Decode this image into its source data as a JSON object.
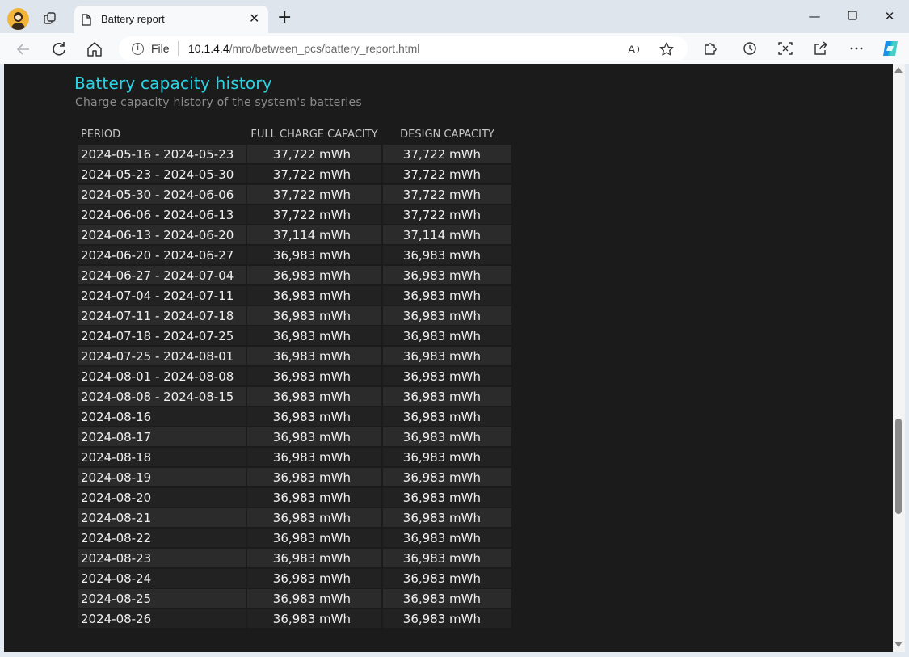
{
  "browser": {
    "tab_title": "Battery report",
    "url_scheme_label": "File",
    "url_host": "10.1.4.4",
    "url_path": "/mro/between_pcs/battery_report.html"
  },
  "report": {
    "title": "Battery capacity history",
    "subtitle": "Charge capacity history of the system's batteries",
    "columns": [
      "PERIOD",
      "FULL CHARGE CAPACITY",
      "DESIGN CAPACITY"
    ],
    "rows": [
      [
        "2024-05-16 - 2024-05-23",
        "37,722 mWh",
        "37,722 mWh"
      ],
      [
        "2024-05-23 - 2024-05-30",
        "37,722 mWh",
        "37,722 mWh"
      ],
      [
        "2024-05-30 - 2024-06-06",
        "37,722 mWh",
        "37,722 mWh"
      ],
      [
        "2024-06-06 - 2024-06-13",
        "37,722 mWh",
        "37,722 mWh"
      ],
      [
        "2024-06-13 - 2024-06-20",
        "37,114 mWh",
        "37,114 mWh"
      ],
      [
        "2024-06-20 - 2024-06-27",
        "36,983 mWh",
        "36,983 mWh"
      ],
      [
        "2024-06-27 - 2024-07-04",
        "36,983 mWh",
        "36,983 mWh"
      ],
      [
        "2024-07-04 - 2024-07-11",
        "36,983 mWh",
        "36,983 mWh"
      ],
      [
        "2024-07-11 - 2024-07-18",
        "36,983 mWh",
        "36,983 mWh"
      ],
      [
        "2024-07-18 - 2024-07-25",
        "36,983 mWh",
        "36,983 mWh"
      ],
      [
        "2024-07-25 - 2024-08-01",
        "36,983 mWh",
        "36,983 mWh"
      ],
      [
        "2024-08-01 - 2024-08-08",
        "36,983 mWh",
        "36,983 mWh"
      ],
      [
        "2024-08-08 - 2024-08-15",
        "36,983 mWh",
        "36,983 mWh"
      ],
      [
        "2024-08-16",
        "36,983 mWh",
        "36,983 mWh"
      ],
      [
        "2024-08-17",
        "36,983 mWh",
        "36,983 mWh"
      ],
      [
        "2024-08-18",
        "36,983 mWh",
        "36,983 mWh"
      ],
      [
        "2024-08-19",
        "36,983 mWh",
        "36,983 mWh"
      ],
      [
        "2024-08-20",
        "36,983 mWh",
        "36,983 mWh"
      ],
      [
        "2024-08-21",
        "36,983 mWh",
        "36,983 mWh"
      ],
      [
        "2024-08-22",
        "36,983 mWh",
        "36,983 mWh"
      ],
      [
        "2024-08-23",
        "36,983 mWh",
        "36,983 mWh"
      ],
      [
        "2024-08-24",
        "36,983 mWh",
        "36,983 mWh"
      ],
      [
        "2024-08-25",
        "36,983 mWh",
        "36,983 mWh"
      ],
      [
        "2024-08-26",
        "36,983 mWh",
        "36,983 mWh"
      ]
    ]
  },
  "icons": {
    "profile": "profile-avatar-icon",
    "workspaces": "workspaces-icon",
    "tab_page": "page-icon",
    "close_tab": "close-icon",
    "new_tab": "plus-icon",
    "minimize": "minimize-icon",
    "maximize": "maximize-icon",
    "close_window": "close-icon",
    "back": "back-arrow-icon",
    "refresh": "refresh-icon",
    "home": "home-icon",
    "site_info": "info-icon",
    "read_aloud": "read-aloud-icon",
    "favorite": "star-icon",
    "extensions": "puzzle-icon",
    "history": "history-icon",
    "screenshot": "screenshot-icon",
    "share": "share-icon",
    "more": "more-icon",
    "copilot": "copilot-icon"
  },
  "colors": {
    "page_background": "#1b1b1b",
    "heading_accent": "#2ad4e4",
    "row_odd": "#2b2b2b",
    "row_even": "#222222"
  }
}
